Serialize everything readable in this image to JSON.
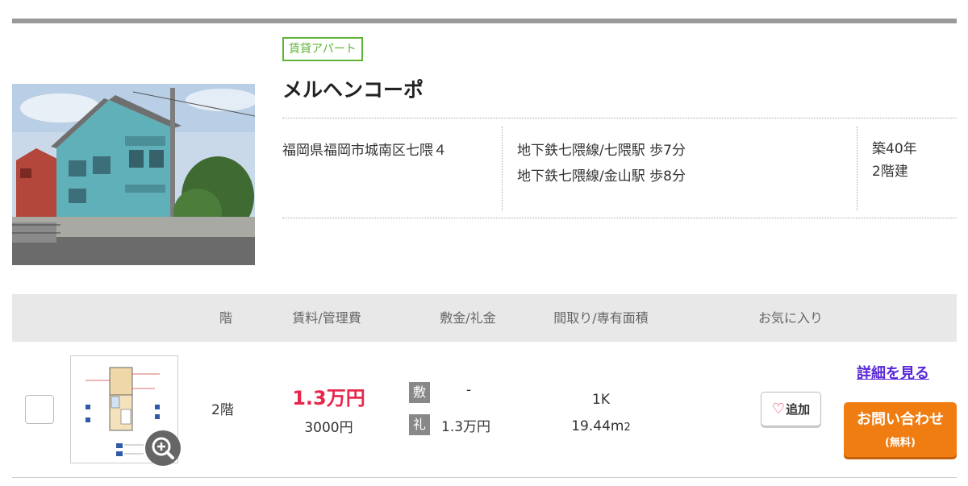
{
  "property": {
    "type_tag": "賃貸アパート",
    "name": "メルヘンコーポ",
    "address": "福岡県福岡市城南区七隈４",
    "stations": [
      "地下鉄七隈線/七隈駅 歩7分",
      "地下鉄七隈線/金山駅 歩8分"
    ],
    "age": "築40年",
    "floors": "2階建"
  },
  "table_headers": {
    "floor": "階",
    "rent": "賃料/管理費",
    "deposit": "敷金/礼金",
    "layout": "間取り/専有面積",
    "favorite": "お気に入り"
  },
  "unit": {
    "floor": "2階",
    "rent": "1.3万円",
    "management_fee": "3000円",
    "deposit_label": "敷",
    "deposit": "-",
    "key_money_label": "礼",
    "key_money": "1.3万円",
    "layout": "1K",
    "area": "19.44m",
    "area_unit_sup": "2"
  },
  "actions": {
    "favorite_add": "追加",
    "detail_link": "詳細を見る",
    "contact_main": "お問い合わせ",
    "contact_sub": "(無料)"
  },
  "colors": {
    "tag": "#5db537",
    "rent": "#e8254a",
    "contact_button": "#f07d12",
    "link": "#5b28d8",
    "header_bg": "#e8e8e8"
  },
  "icons": [
    "heart-icon",
    "zoom-in-icon"
  ]
}
